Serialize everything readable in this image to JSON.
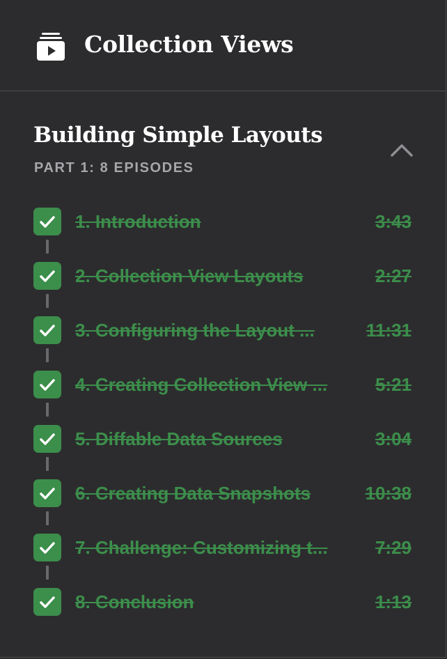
{
  "header": {
    "title": "Collection Views",
    "icon": "video-playlist-icon"
  },
  "section": {
    "title": "Building Simple Layouts",
    "subtitle": "PART 1: 8 EPISODES",
    "expanded": true,
    "collapse_icon": "chevron-up-icon"
  },
  "episodes": [
    {
      "title": "1. Introduction",
      "duration": "3:43",
      "completed": true
    },
    {
      "title": "2. Collection View Layouts",
      "duration": "2:27",
      "completed": true
    },
    {
      "title": "3. Configuring the Layout ...",
      "duration": "11:31",
      "completed": true
    },
    {
      "title": "4. Creating Collection View ...",
      "duration": "5:21",
      "completed": true
    },
    {
      "title": "5. Diffable Data Sources",
      "duration": "3:04",
      "completed": true
    },
    {
      "title": "6. Creating Data Snapshots",
      "duration": "10:38",
      "completed": true
    },
    {
      "title": "7. Challenge: Customizing t...",
      "duration": "7:29",
      "completed": true
    },
    {
      "title": "8. Conclusion",
      "duration": "1:13",
      "completed": true
    }
  ],
  "colors": {
    "background": "#2c2c2e",
    "completed_green": "#3c8e4b",
    "subtitle_gray": "#a7a7ab",
    "connector_gray": "#68686d"
  }
}
